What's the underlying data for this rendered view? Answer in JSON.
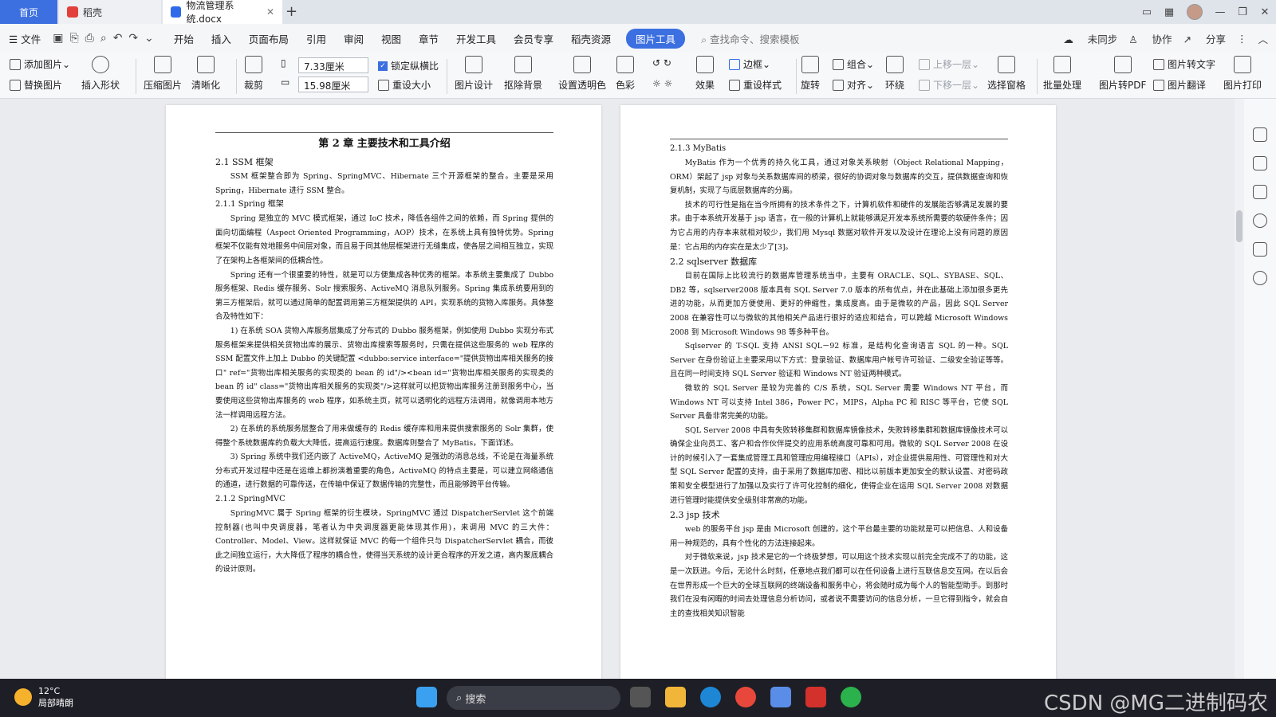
{
  "tabs": {
    "home": "首页",
    "daoke": "稻壳",
    "doc": "物流管理系统.docx"
  },
  "menu": {
    "file": "文件",
    "items": [
      "开始",
      "插入",
      "页面布局",
      "引用",
      "审阅",
      "视图",
      "章节",
      "开发工具",
      "会员专享",
      "稻壳资源"
    ],
    "active": "图片工具",
    "search": "查找命令、搜索模板",
    "sync": "未同步",
    "collab": "协作",
    "share": "分享"
  },
  "ribbon": {
    "add_image": "添加图片",
    "replace_image": "替换图片",
    "insert_shape": "插入形状",
    "compress": "压缩图片",
    "sharpen": "清晰化",
    "crop": "裁剪",
    "width": "7.33厘米",
    "height": "15.98厘米",
    "lock_ratio": "锁定纵横比",
    "reset_size": "重设大小",
    "design": "图片设计",
    "remove_bg": "抠除背景",
    "set_transparent": "设置透明色",
    "color": "色彩",
    "effect": "效果",
    "border": "边框",
    "reset_style": "重设样式",
    "rotate": "旋转",
    "group": "组合",
    "align": "对齐",
    "wrap": "环绕",
    "up_layer": "上移一层",
    "down_layer": "下移一层",
    "select_pane": "选择窗格",
    "batch": "批量处理",
    "to_pdf": "图片转PDF",
    "to_text": "图片转文字",
    "translate": "图片翻译",
    "print": "图片打印"
  },
  "page1": {
    "h1": "第 2 章 主要技术和工具介绍",
    "h_ssm": "2.1 SSM 框架",
    "p_ssm": "SSM 框架整合即为 Spring、SpringMVC、Hibernate 三个开源框架的整合。主要是采用 Spring，Hibernate 进行 SSM 整合。",
    "h_spring": "2.1.1 Spring 框架",
    "p_spring1": "Spring 是独立的 MVC 模式框架，通过 IoC 技术，降低各组件之间的依赖，而 Spring 提供的面向切面编程（Aspect Oriented Programming，AOP）技术，在系统上具有独特优势。Spring 框架不仅能有效地服务中间层对象，而且易于同其他层框架进行无缝集成，使各层之间相互独立，实现了在架构上各框架间的低耦合性。",
    "p_spring2": "Spring 还有一个很重要的特性，就是可以方便集成各种优秀的框架。本系统主要集成了 Dubbo 服务框架、Redis 缓存服务、Solr 搜索服务、ActiveMQ 消息队列服务。Spring 集成系统要用到的第三方框架后，就可以通过简单的配置调用第三方框架提供的 API，实现系统的货物入库服务。具体整合及特性如下：",
    "p_spring3": "1) 在系统 SOA 货物入库服务层集成了分布式的 Dubbo 服务框架，例如使用 Dubbo 实现分布式服务框架来提供相关货物出库的展示、货物出库搜索等服务时，只需在提供这些服务的 web 程序的 SSM 配置文件上加上 Dubbo 的关键配置 <dubbo:service interface=\"提供货物出库相关服务的接口\" ref=\"货物出库相关服务的实现类的 bean 的 id\"/><bean id=\"货物出库相关服务的实现类的 bean 的 id\" class=\"货物出库相关服务的实现类\"/>这样就可以把货物出库服务注册到服务中心，当要使用这些货物出库服务的 web 程序，如系统主页，就可以透明化的远程方法调用，就像调用本地方法一样调用远程方法。",
    "p_spring4": "2) 在系统的系统服务层整合了用来做缓存的 Redis 缓存库和用来提供搜索服务的 Solr 集群，使得整个系统数据库的负载大大降低，提高运行速度。数据库则整合了 MyBatis，下面详述。",
    "p_spring5": "3) Spring 系统中我们还内嵌了 ActiveMQ，ActiveMQ 是强劲的消息总线，不论是在海量系统分布式开发过程中还是在运维上都扮演着重要的角色，ActiveMQ 的特点主要是，可以建立网络通信的通道，进行数据的可靠传送，在传输中保证了数据传输的完整性，而且能够跨平台传输。",
    "h_mvc": "2.1.2 SpringMVC",
    "p_mvc": "SpringMVC 属于 Spring 框架的衍生模块，SpringMVC 通过 DispatcherServlet 这个前端控制器(也叫中央调度器，笔者认为中央调度器更能体现其作用)，来调用 MVC 的三大件：Controller、Model、View。这样就保证 MVC 的每一个组件只与 DispatcherServlet 耦合，而彼此之间独立运行，大大降低了程序的耦合性，使得当天系统的设计更合程序的开发之道，高内聚底耦合的设计原则。"
  },
  "page2": {
    "h_mybatis": "2.1.3 MyBatis",
    "p_mybatis1": "MyBatis 作为一个优秀的持久化工具，通过对象关系映射（Object Relational Mapping，ORM）架起了 jsp 对象与关系数据库间的桥梁，很好的协调对象与数据库的交互，提供数据查询和恢复机制，实现了与底层数据库的分离。",
    "p_mybatis2": "技术的可行性是指在当今所拥有的技术条件之下，计算机软件和硬件的发展能否够满足发展的要求。由于本系统开发基于 jsp 语言，在一般的计算机上就能够满足开发本系统所需要的软硬件条件；因为它占用的内存本来就相对较少，我们用 Mysql 数据对软件开发以及设计在理论上没有问题的原因是：它占用的内存实在是太少了[3]。",
    "h_sql": "2.2 sqlserver 数据库",
    "p_sql1": "目前在国际上比较流行的数据库管理系统当中，主要有 ORACLE、SQL、SYBASE、SQL、DB2 等，sqlserver2008 版本具有 SQL Server 7.0 版本的所有优点，并在此基础上添加很多更先进的功能，从而更加方便使用、更好的伸缩性，集成度高。由于是微软的产品，因此 SQL Server 2008 在兼容性可以与微软的其他相关产品进行很好的适应和结合，可以跨越 Microsoft Windows 2008 到 Microsoft Windows 98 等多种平台。",
    "p_sql2": "Sqlserver 的 T-SQL 支持 ANSI SQL－92 标准，是结构化查询语言 SQL 的一种。SQL Server 在身份验证上主要采用以下方式：登录验证、数据库用户帐号许可验证、二级安全验证等等。且在同一时间支持 SQL Server 验证和 Windows NT 验证两种模式。",
    "p_sql3": "微软的 SQL Server 是较为完善的 C/S 系统，SQL Server 需要 Windows NT 平台，而 Windows NT 可以支持 Intel 386，Power PC，MIPS，Alpha PC 和 RISC 等平台，它使 SQL Server 具备非常完美的功能。",
    "p_sql4": "SQL Server 2008 中具有失败转移集群和数据库镜像技术，失败转移集群和数据库镜像技术可以确保企业向员工、客户和合作伙伴提交的应用系统高度可靠和可用。微软的 SQL Server 2008 在设计的时候引入了一套集成管理工具和管理应用编程接口（APIs），对企业提供易用性、可管理性和对大型 SQL Server 配置的支持，由于采用了数据库加密、相比以前版本更加安全的默认设置、对密码政策和安全模型进行了加强以及实行了许可化控制的细化，使得企业在运用 SQL Server 2008 对数据进行管理时能提供安全级别非常高的功能。",
    "h_jsp": "2.3 jsp 技术",
    "p_jsp1": "web 的服务平台 jsp 是由 Microsoft 创建的，这个平台最主要的功能就是可以把信息、人和设备用一种规范的，具有个性化的方法连接起来。",
    "p_jsp2": "对于微软来说，jsp 技术是它的一个终极梦想，可以用这个技术实现以前完全完成不了的功能，这是一次跃进。今后，无论什么时刻，任意地点我们都可以在任何设备上进行互联信息交互网。在以后会在世界形成一个巨大的全球互联网的终端设备和服务中心，将会随时成为每个人的智能型助手。到那时我们在没有闲暇的时间去处理信息分析访问，或者说不需要访问的信息分析，一旦它得到指令，就会自主的查找相关知识智能"
  },
  "taskbar": {
    "temp": "12°C",
    "weather": "局部晴朗",
    "search": "搜索",
    "watermark": "CSDN @MG二进制码农"
  }
}
